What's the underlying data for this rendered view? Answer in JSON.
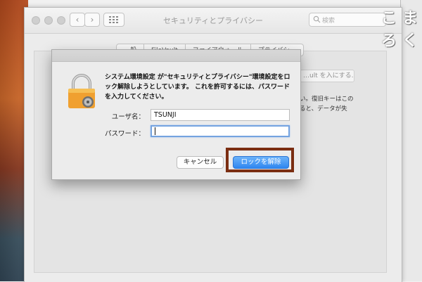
{
  "window": {
    "title": "セキュリティとプライバシー",
    "search_placeholder": "検索"
  },
  "logo_chars": [
    "こ",
    "ま",
    "ろ",
    "く"
  ],
  "background": {
    "tabs": [
      "一般",
      "FileVault",
      "ファイアウォール",
      "プライバシー"
    ],
    "button_partial": "…ult を入にする…",
    "text_lines": [
      "い。復旧キーはこの",
      "ると、データが失"
    ]
  },
  "dialog": {
    "message": "システム環境設定 が\"セキュリティとプライバシー\"環境設定をロック解除しようとしています。 これを許可するには、パスワードを入力してください。",
    "username_label": "ユーザ名：",
    "username_value": "TSUNJI",
    "password_label": "パスワード：",
    "password_value": "",
    "cancel_label": "キャンセル",
    "unlock_label": "ロックを解除"
  },
  "colors": {
    "primary_button": "#2f86f0",
    "highlight_frame": "#7b2e12",
    "lock_body": "#f0a030"
  }
}
